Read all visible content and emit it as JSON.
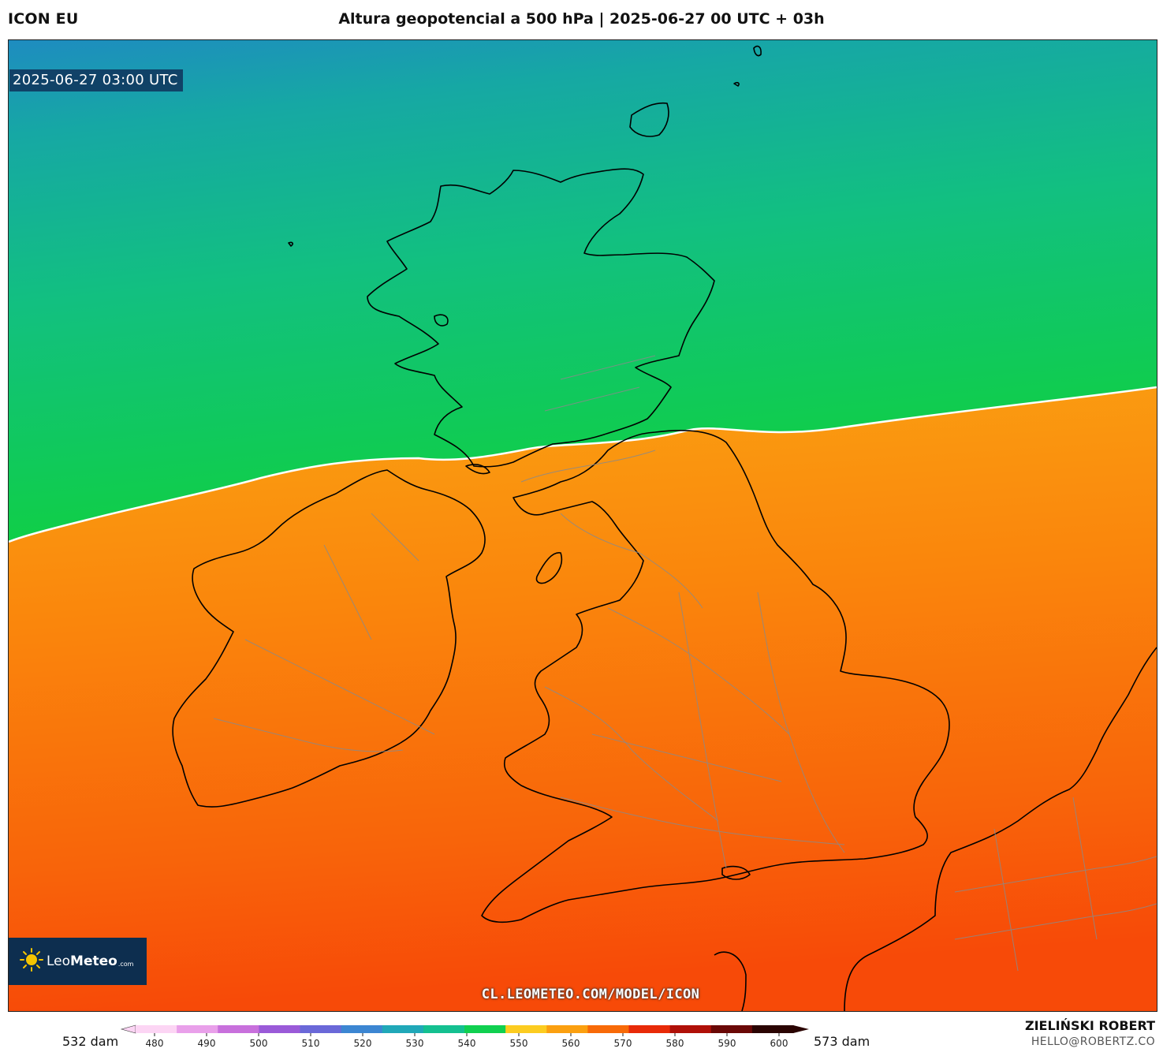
{
  "header": {
    "model": "ICON EU",
    "title": "Altura geopotencial a 500 hPa | 2025-06-27 00 UTC + 03h"
  },
  "map": {
    "valid_time": "2025-06-27 03:00 UTC",
    "logo": {
      "brand_light": "Leo",
      "brand_bold": "Meteo",
      "suffix": ".com"
    },
    "url": "CL.LEOMETEO.COM/MODEL/ICON",
    "colors": {
      "teal_north": "#1aa0a8",
      "green": "#12cc4a",
      "yellow": "#fdd12a",
      "orange": "#fb9a0a",
      "red_orange": "#f8500a"
    }
  },
  "colorbar": {
    "min_label": "532 dam",
    "max_label": "573 dam",
    "ticks": [
      "480",
      "490",
      "500",
      "510",
      "520",
      "530",
      "540",
      "550",
      "560",
      "570",
      "580",
      "590",
      "600"
    ],
    "colors": [
      "#fcd5f4",
      "#e9a0ea",
      "#c870dc",
      "#9a5ad8",
      "#6a68d8",
      "#3c86d2",
      "#20a8b8",
      "#14c090",
      "#10d050",
      "#fccc20",
      "#fba010",
      "#f86a08",
      "#e82a08",
      "#b01008",
      "#6a0806",
      "#2a0402"
    ]
  },
  "author": {
    "name": "ZIELIŃSKI ROBERT",
    "email": "HELLO@ROBERTZ.CO"
  }
}
